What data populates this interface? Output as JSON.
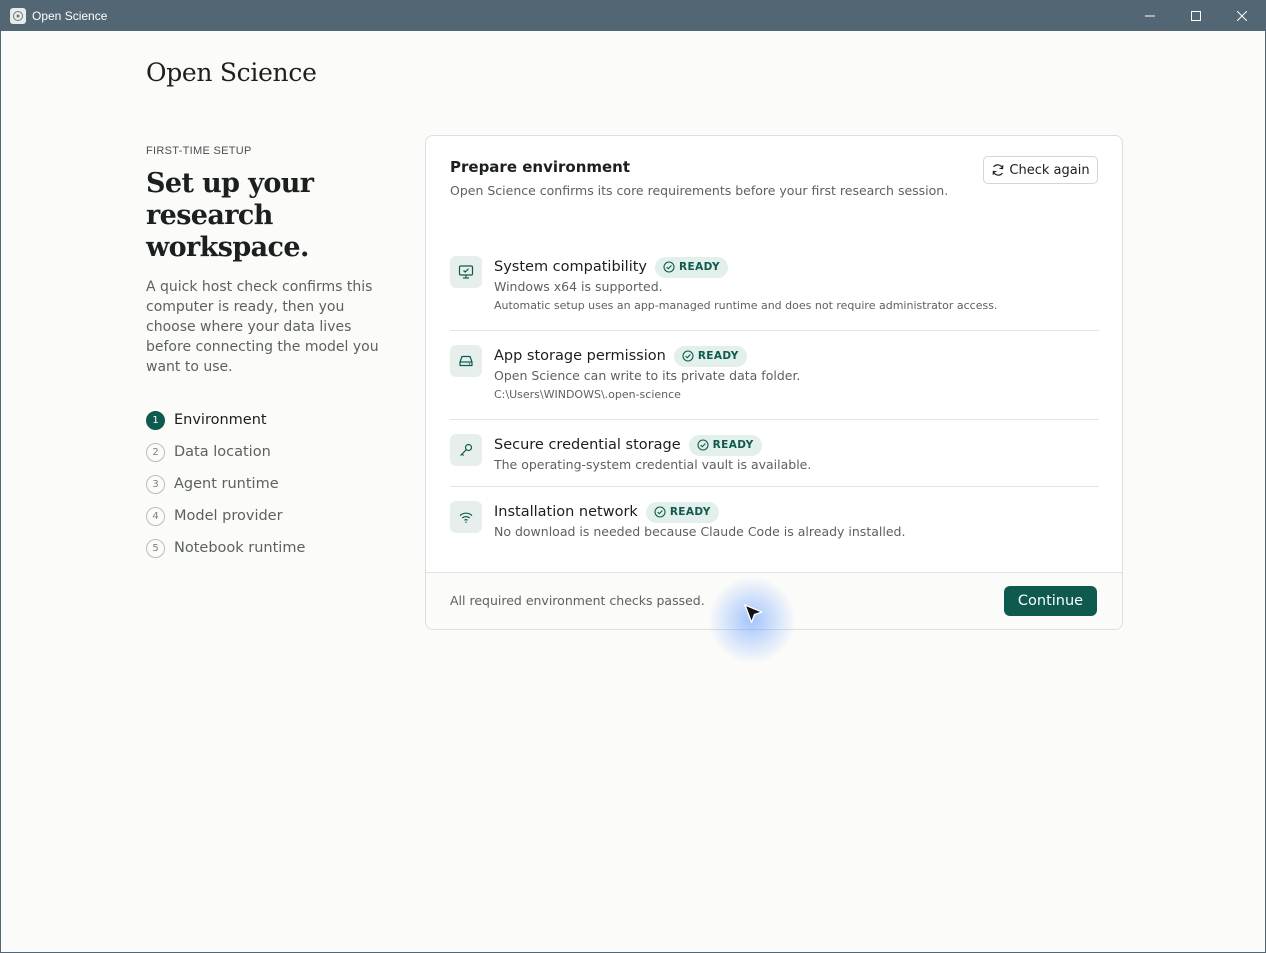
{
  "window": {
    "title": "Open Science"
  },
  "brand": "Open Science",
  "sidebar": {
    "eyebrow": "FIRST-TIME SETUP",
    "heading": "Set up your research workspace.",
    "intro": "A quick host check confirms this computer is ready, then you choose where your data lives before connecting the model you want to use.",
    "steps": [
      {
        "num": "1",
        "label": "Environment",
        "active": true
      },
      {
        "num": "2",
        "label": "Data location",
        "active": false
      },
      {
        "num": "3",
        "label": "Agent runtime",
        "active": false
      },
      {
        "num": "4",
        "label": "Model provider",
        "active": false
      },
      {
        "num": "5",
        "label": "Notebook runtime",
        "active": false
      }
    ]
  },
  "card": {
    "title": "Prepare environment",
    "subtitle": "Open Science confirms its core requirements before your first research session.",
    "check_again_label": "Check again",
    "checks": [
      {
        "title": "System compatibility",
        "status": "READY",
        "icon": "monitor-check-icon",
        "desc": "Windows x64 is supported.",
        "note": "Automatic setup uses an app-managed runtime and does not require administrator access."
      },
      {
        "title": "App storage permission",
        "status": "READY",
        "icon": "hard-drive-icon",
        "desc": "Open Science can write to its private data folder.",
        "note": "C:\\Users\\WINDOWS\\.open-science"
      },
      {
        "title": "Secure credential storage",
        "status": "READY",
        "icon": "key-icon",
        "desc": "The operating-system credential vault is available."
      },
      {
        "title": "Installation network",
        "status": "READY",
        "icon": "wifi-icon",
        "desc": "No download is needed because Claude Code is already installed."
      }
    ],
    "footer_text": "All required environment checks passed.",
    "continue_label": "Continue"
  },
  "colors": {
    "accent": "#0e5a4f",
    "titlebar": "#536673",
    "badge_bg": "#e3efea"
  }
}
